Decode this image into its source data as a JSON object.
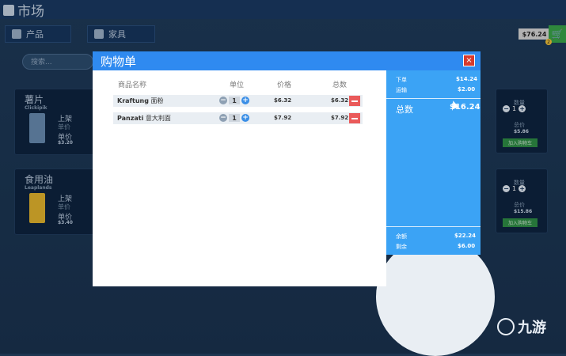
{
  "market": {
    "title": "市场"
  },
  "nav": {
    "products": "产品",
    "furniture": "家具"
  },
  "topbar": {
    "money": "$76.24",
    "cart_count": "2"
  },
  "search": {
    "placeholder": "搜索..."
  },
  "cards_left": [
    {
      "name": "薯片",
      "brand": "Clickipik",
      "label1": "上架",
      "label2": "单价",
      "label3": "单价",
      "price": "$3.20"
    },
    {
      "name": "食用油",
      "brand": "Leaplands",
      "label1": "上架",
      "label2": "单价",
      "label3": "单价",
      "price": "$3.40"
    }
  ],
  "cards_right": [
    {
      "qty_label": "数量",
      "qty": "1",
      "total_label": "总价",
      "price": "$5.86",
      "add": "加入购物车"
    },
    {
      "qty_label": "数量",
      "qty": "1",
      "total_label": "总价",
      "price": "$15.86",
      "add": "加入购物车"
    }
  ],
  "modal": {
    "title": "购物单",
    "close": "×",
    "headers": {
      "name": "商品名称",
      "unit": "单位",
      "price": "价格",
      "total": "总数"
    },
    "items": [
      {
        "brand": "Kraftung",
        "name": "面粉",
        "qty": "1",
        "price": "$6.32",
        "total": "$6.32"
      },
      {
        "brand": "Panzati",
        "name": "意大利面",
        "qty": "1",
        "price": "$7.92",
        "total": "$7.92"
      }
    ]
  },
  "summary": {
    "order_label": "下单",
    "order_value": "$14.24",
    "shipping_label": "运输",
    "shipping_value": "$2.00",
    "total_label": "总数",
    "total_value": "$16.24",
    "balance_label": "余额",
    "balance_value": "$22.24",
    "remaining_label": "剩余",
    "remaining_value": "$6.00"
  },
  "watermark": {
    "text": "九游"
  }
}
